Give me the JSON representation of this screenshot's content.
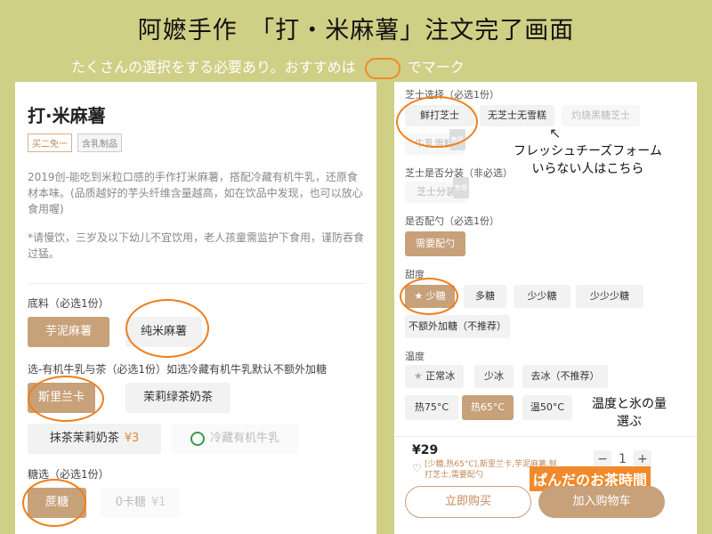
{
  "header": {
    "title": "阿嬷手作　「打・米麻薯」注文完了画面",
    "subtitle_pre": "たくさんの選択をする必要あり。おすすめは",
    "subtitle_post": "でマーク"
  },
  "product": {
    "name": "打·米麻薯",
    "tags": [
      "买二免一",
      "含乳制品"
    ],
    "description": "2019创-能吃到米粒口感的手作打米麻薯，搭配冷藏有机牛乳，还原食材本味。(品质越好的芋头纤维含量越高，如在饮品中发现，也可以放心食用喔)",
    "warning": "*请慢饮，三岁及以下幼儿不宜饮用，老人孩童需监护下食用，谨防吞食过猛。"
  },
  "left_options": {
    "base_label": "底料（必选1份）",
    "base_items": [
      "芋泥麻薯",
      "纯米麻薯"
    ],
    "milk_label": "选-有机牛乳与茶（必选1份）如选冷藏有机牛乳默认不额外加糖",
    "milk_items": [
      "斯里兰卡",
      "茉莉绿茶奶茶",
      "抹茶茉莉奶茶",
      "冷藏有机牛乳"
    ],
    "milk_price": "¥3",
    "sugar_label": "糖选（必选1份）",
    "sugar_items": [
      "蔗糖",
      "0卡糖"
    ],
    "sugar_price": "¥1"
  },
  "right_options": {
    "cheese_label": "芝士选择（必选1份）",
    "cheese_items": [
      "鲜打芝士",
      "无芝士无雪糕",
      "灼烧黑糖芝士",
      "牛乳雪糕"
    ],
    "cheese_split_label": "芝士是否分装（非必选）",
    "cheese_split_item": "芝士分装",
    "spoon_label": "是否配勺（必选1份）",
    "spoon_item": "需要配勺",
    "sweet_label": "甜度",
    "sweet_items": [
      "少糖",
      "多糖",
      "少少糖",
      "少少少糖",
      "不额外加糖（不推荐）"
    ],
    "temp_label": "温度",
    "temp_items": [
      "正常冰",
      "少冰",
      "去冰（不推荐）",
      "热75°C",
      "热65°C",
      "温50°C"
    ],
    "badge": "售罄"
  },
  "footer": {
    "price": "¥29",
    "spec": "[少糖,热65°C],斯里兰卡,芋泥麻薯,鲜打芝士,需要配勺",
    "qty": "1",
    "minus": "−",
    "plus": "+",
    "buy_now": "立即购买",
    "add_cart": "加入购物车"
  },
  "annotations": {
    "fresh_cheese_note": "フレッシュチーズフォーム\nいらない人はこちら",
    "temp_note": "温度と氷の量\n選ぶ",
    "brand": "ぱんだのお茶時間"
  },
  "colors": {
    "background": "#cfcf86",
    "accent": "#c7a17a",
    "marker": "#f07e1c"
  }
}
